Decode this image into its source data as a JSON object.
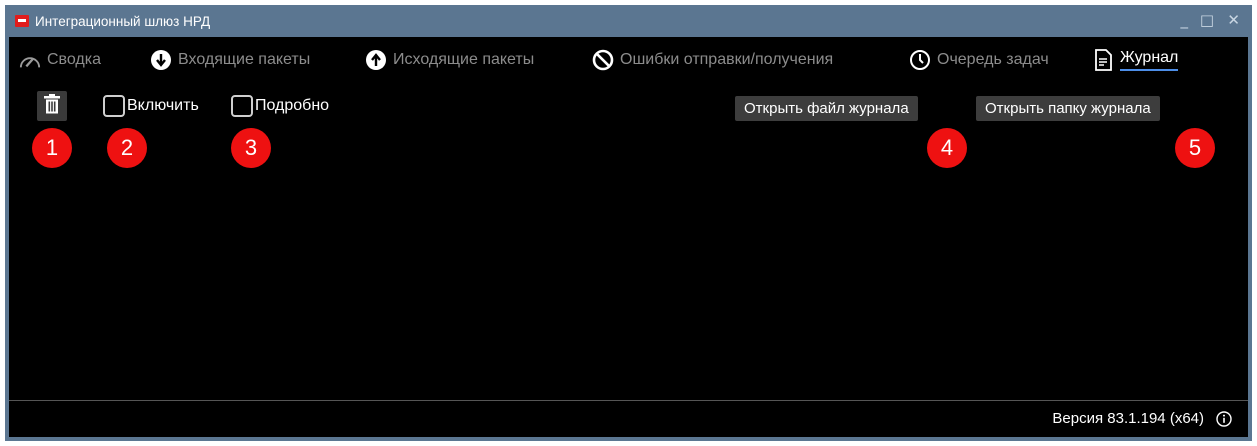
{
  "window": {
    "title": "Интеграционный шлюз НРД",
    "controls": {
      "minimize": "_",
      "maximize": "□",
      "close": "✕"
    }
  },
  "tabs": [
    {
      "label": "Сводка",
      "icon": "gauge-icon"
    },
    {
      "label": "Входящие пакеты",
      "icon": "arrow-down-circle-icon"
    },
    {
      "label": "Исходящие пакеты",
      "icon": "arrow-up-circle-icon"
    },
    {
      "label": "Ошибки отправки/получения",
      "icon": "prohibited-icon"
    },
    {
      "label": "Очередь задач",
      "icon": "clock-icon"
    },
    {
      "label": "Журнал",
      "icon": "document-icon",
      "active": true
    }
  ],
  "toolbar": {
    "enable_label": "Включить",
    "verbose_label": "Подробно",
    "open_log_file": "Открыть файл журнала",
    "open_log_folder": "Открыть папку журнала"
  },
  "badges": [
    "1",
    "2",
    "3",
    "4",
    "5"
  ],
  "status": {
    "version": "Версия 83.1.194 (x64)"
  },
  "colors": {
    "titlebar": "#5b7691",
    "badge": "#ee1111",
    "active_underline": "#4d8ee8",
    "background": "#000000"
  }
}
